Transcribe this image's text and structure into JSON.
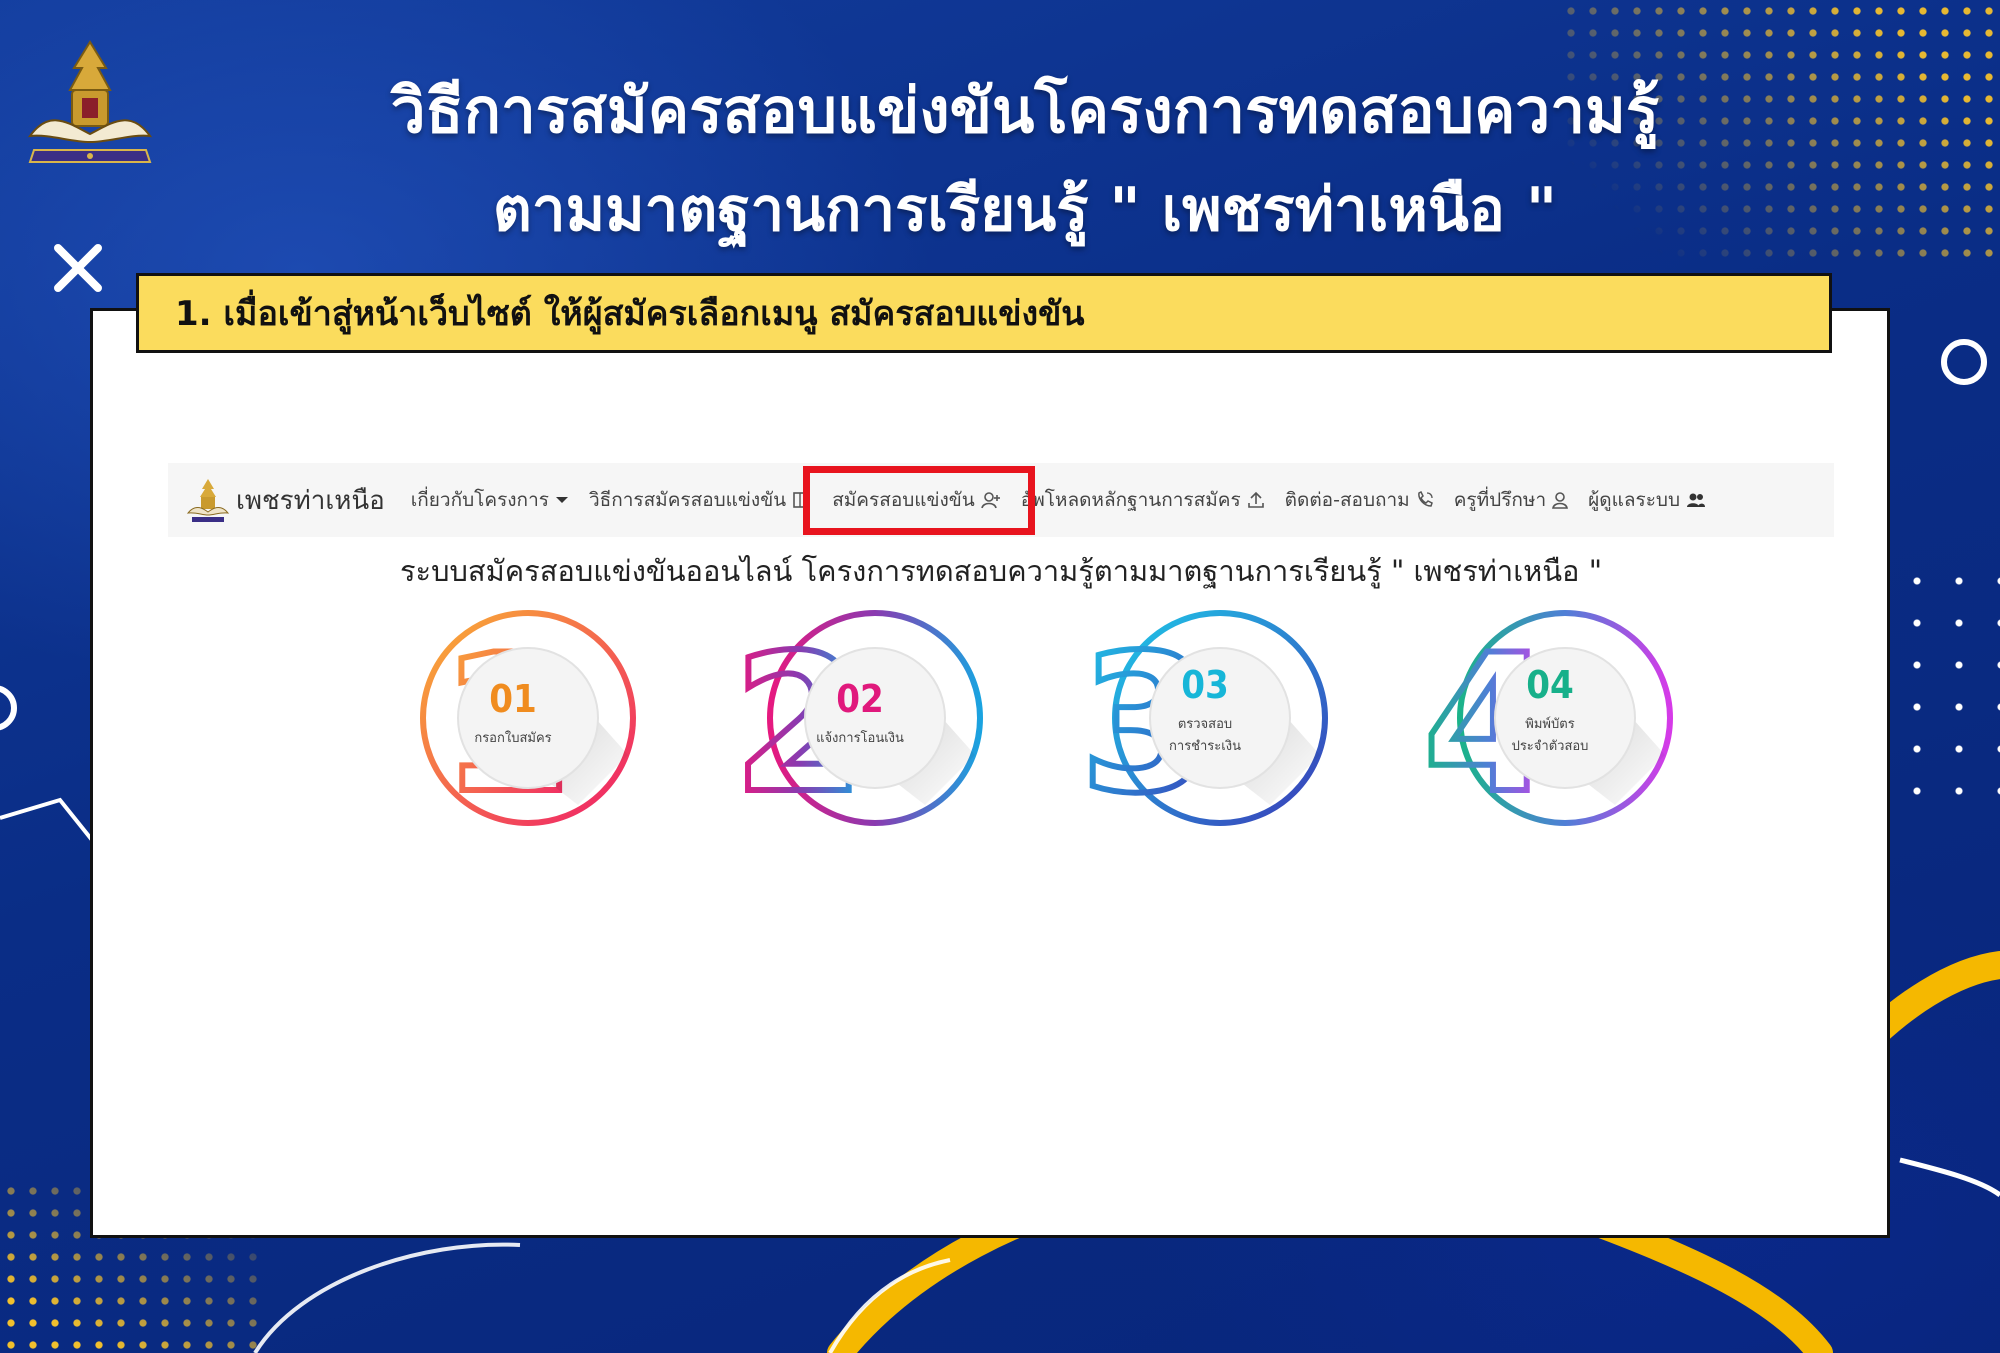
{
  "slide": {
    "title_line1": "วิธีการสมัครสอบแข่งขันโครงการทดสอบความรู้",
    "title_line2": "ตามมาตฐานการเรียนรู้ \" เพชรท่าเหนือ \"",
    "instruction": "1. เมื่อเข้าสู่หน้าเว็บไซต์ ให้ผู้สมัครเลือกเมนู สมัครสอบแข่งขัน",
    "logo_icon": "school-crest"
  },
  "site": {
    "brand": "เพชรท่าเหนือ",
    "nav": [
      {
        "label": "เกี่ยวกับโครงการ",
        "icon": "caret-down-icon"
      },
      {
        "label": "วิธีการสมัครสอบแข่งขัน",
        "icon": "book-icon"
      },
      {
        "label": "สมัครสอบแข่งขัน",
        "icon": "user-plus-icon"
      },
      {
        "label": "อัพโหลดหลักฐานการสมัคร",
        "icon": "upload-icon"
      },
      {
        "label": "ติดต่อ-สอบถาม",
        "icon": "phone-icon"
      },
      {
        "label": "ครูที่ปรึกษา",
        "icon": "user-icon"
      },
      {
        "label": "ผู้ดูแลระบบ",
        "icon": "users-icon"
      }
    ],
    "subtitle": "ระบบสมัครสอบแข่งขันออนไลน์ โครงการทดสอบความรู้ตามมาตฐานการเรียนรู้ \" เพชรท่าเหนือ \"",
    "steps": [
      {
        "big": "1",
        "num": "01",
        "label1": "กรอกใบสมัคร",
        "label2": "",
        "color1": "#f9b233",
        "color2": "#ef1c6a"
      },
      {
        "big": "2",
        "num": "02",
        "label1": "แจ้งการโอนเงิน",
        "label2": "",
        "color1": "#e6197f",
        "color2": "#1aa3e0"
      },
      {
        "big": "3",
        "num": "03",
        "label1": "ตรวจสอบ",
        "label2": "การชำระเงิน",
        "color1": "#1ec8e8",
        "color2": "#3a3ab8"
      },
      {
        "big": "4",
        "num": "04",
        "label1": "พิมพ์บัตร",
        "label2": "ประจำตัวสอบ",
        "color1": "#1bb38a",
        "color2": "#d63ae8"
      }
    ]
  },
  "colors": {
    "background": "#0b2f86",
    "banner": "#fbdc5d",
    "highlight_box": "#e8141e",
    "accent_gold": "#f5b800"
  }
}
